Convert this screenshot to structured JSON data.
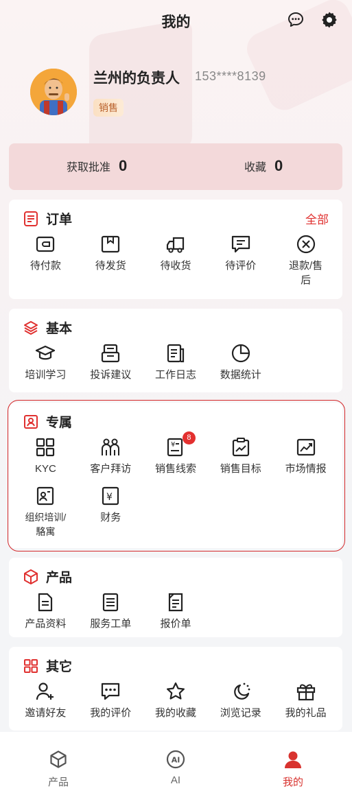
{
  "header": {
    "title": "我的",
    "message_icon": "chat-bubble-icon",
    "settings_icon": "gear-icon"
  },
  "profile": {
    "name": "兰州的负责人",
    "phone": "153****8139",
    "role": "销售"
  },
  "stats": [
    {
      "label": "获取批准",
      "value": "0"
    },
    {
      "label": "收藏",
      "value": "0"
    }
  ],
  "orders": {
    "title": "订单",
    "more": "全部",
    "items": [
      {
        "label": "待付款",
        "icon": "wallet-icon"
      },
      {
        "label": "待发货",
        "icon": "package-icon"
      },
      {
        "label": "待收货",
        "icon": "truck-icon"
      },
      {
        "label": "待评价",
        "icon": "comment-icon"
      },
      {
        "label": "退款/售后",
        "icon": "refund-icon"
      }
    ]
  },
  "basic": {
    "title": "基本",
    "items": [
      {
        "label": "培训学习",
        "icon": "graduation-cap-icon"
      },
      {
        "label": "投诉建议",
        "icon": "feedback-icon"
      },
      {
        "label": "工作日志",
        "icon": "document-icon"
      },
      {
        "label": "数据统计",
        "icon": "pie-chart-icon"
      }
    ]
  },
  "exclusive": {
    "title": "专属",
    "items": [
      {
        "label": "KYC",
        "icon": "grid-icon"
      },
      {
        "label": "客户拜访",
        "icon": "people-icon"
      },
      {
        "label": "销售线索",
        "icon": "sales-lead-icon",
        "badge": "8"
      },
      {
        "label": "销售目标",
        "icon": "target-board-icon"
      },
      {
        "label": "市场情报",
        "icon": "trend-chart-icon"
      },
      {
        "label": "组织培训/駱寓",
        "icon": "id-card-icon"
      },
      {
        "label": "财务",
        "icon": "yuan-icon"
      }
    ]
  },
  "product": {
    "title": "产品",
    "items": [
      {
        "label": "产品资料",
        "icon": "file-icon"
      },
      {
        "label": "服务工单",
        "icon": "list-doc-icon"
      },
      {
        "label": "报价单",
        "icon": "quote-doc-icon"
      }
    ]
  },
  "other": {
    "title": "其它",
    "items": [
      {
        "label": "邀请好友",
        "icon": "add-user-icon"
      },
      {
        "label": "我的评价",
        "icon": "chat-dots-icon"
      },
      {
        "label": "我的收藏",
        "icon": "star-icon"
      },
      {
        "label": "浏览记录",
        "icon": "history-icon"
      },
      {
        "label": "我的礼品",
        "icon": "gift-icon"
      }
    ]
  },
  "tabbar": [
    {
      "label": "产品",
      "icon": "cube-icon"
    },
    {
      "label": "AI",
      "icon": "ai-icon"
    },
    {
      "label": "我的",
      "icon": "user-icon",
      "active": true
    }
  ],
  "colors": {
    "accent": "#e0302f",
    "stats_bg": "#f3d9da",
    "badge_bg": "#fde4c8"
  }
}
